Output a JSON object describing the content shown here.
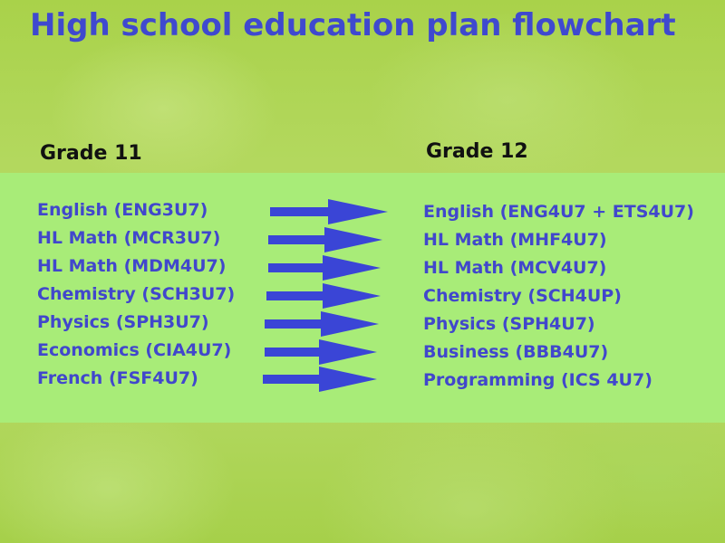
{
  "title": "High school education plan flowchart",
  "grade11": {
    "heading": "Grade 11",
    "courses": [
      "English (ENG3U7)",
      "HL Math (MCR3U7)",
      "HL Math (MDM4U7)",
      "Chemistry (SCH3U7)",
      "Physics (SPH3U7)",
      "Economics (CIA4U7)",
      "French (FSF4U7)"
    ]
  },
  "grade12": {
    "heading": "Grade 12",
    "courses": [
      "English (ENG4U7 + ETS4U7)",
      "HL Math (MHF4U7)",
      "HL Math (MCV4U7)",
      "Chemistry (SCH4UP)",
      "Physics (SPH4U7)",
      "Business (BBB4U7)",
      "Programming (ICS 4U7)"
    ]
  },
  "colors": {
    "title": "#3f49cf",
    "course_text": "#4147cc",
    "arrow": "#3a45d6",
    "panel": "#a8ec78",
    "heading": "#111111"
  },
  "arrow_icon": "right-arrow-icon"
}
